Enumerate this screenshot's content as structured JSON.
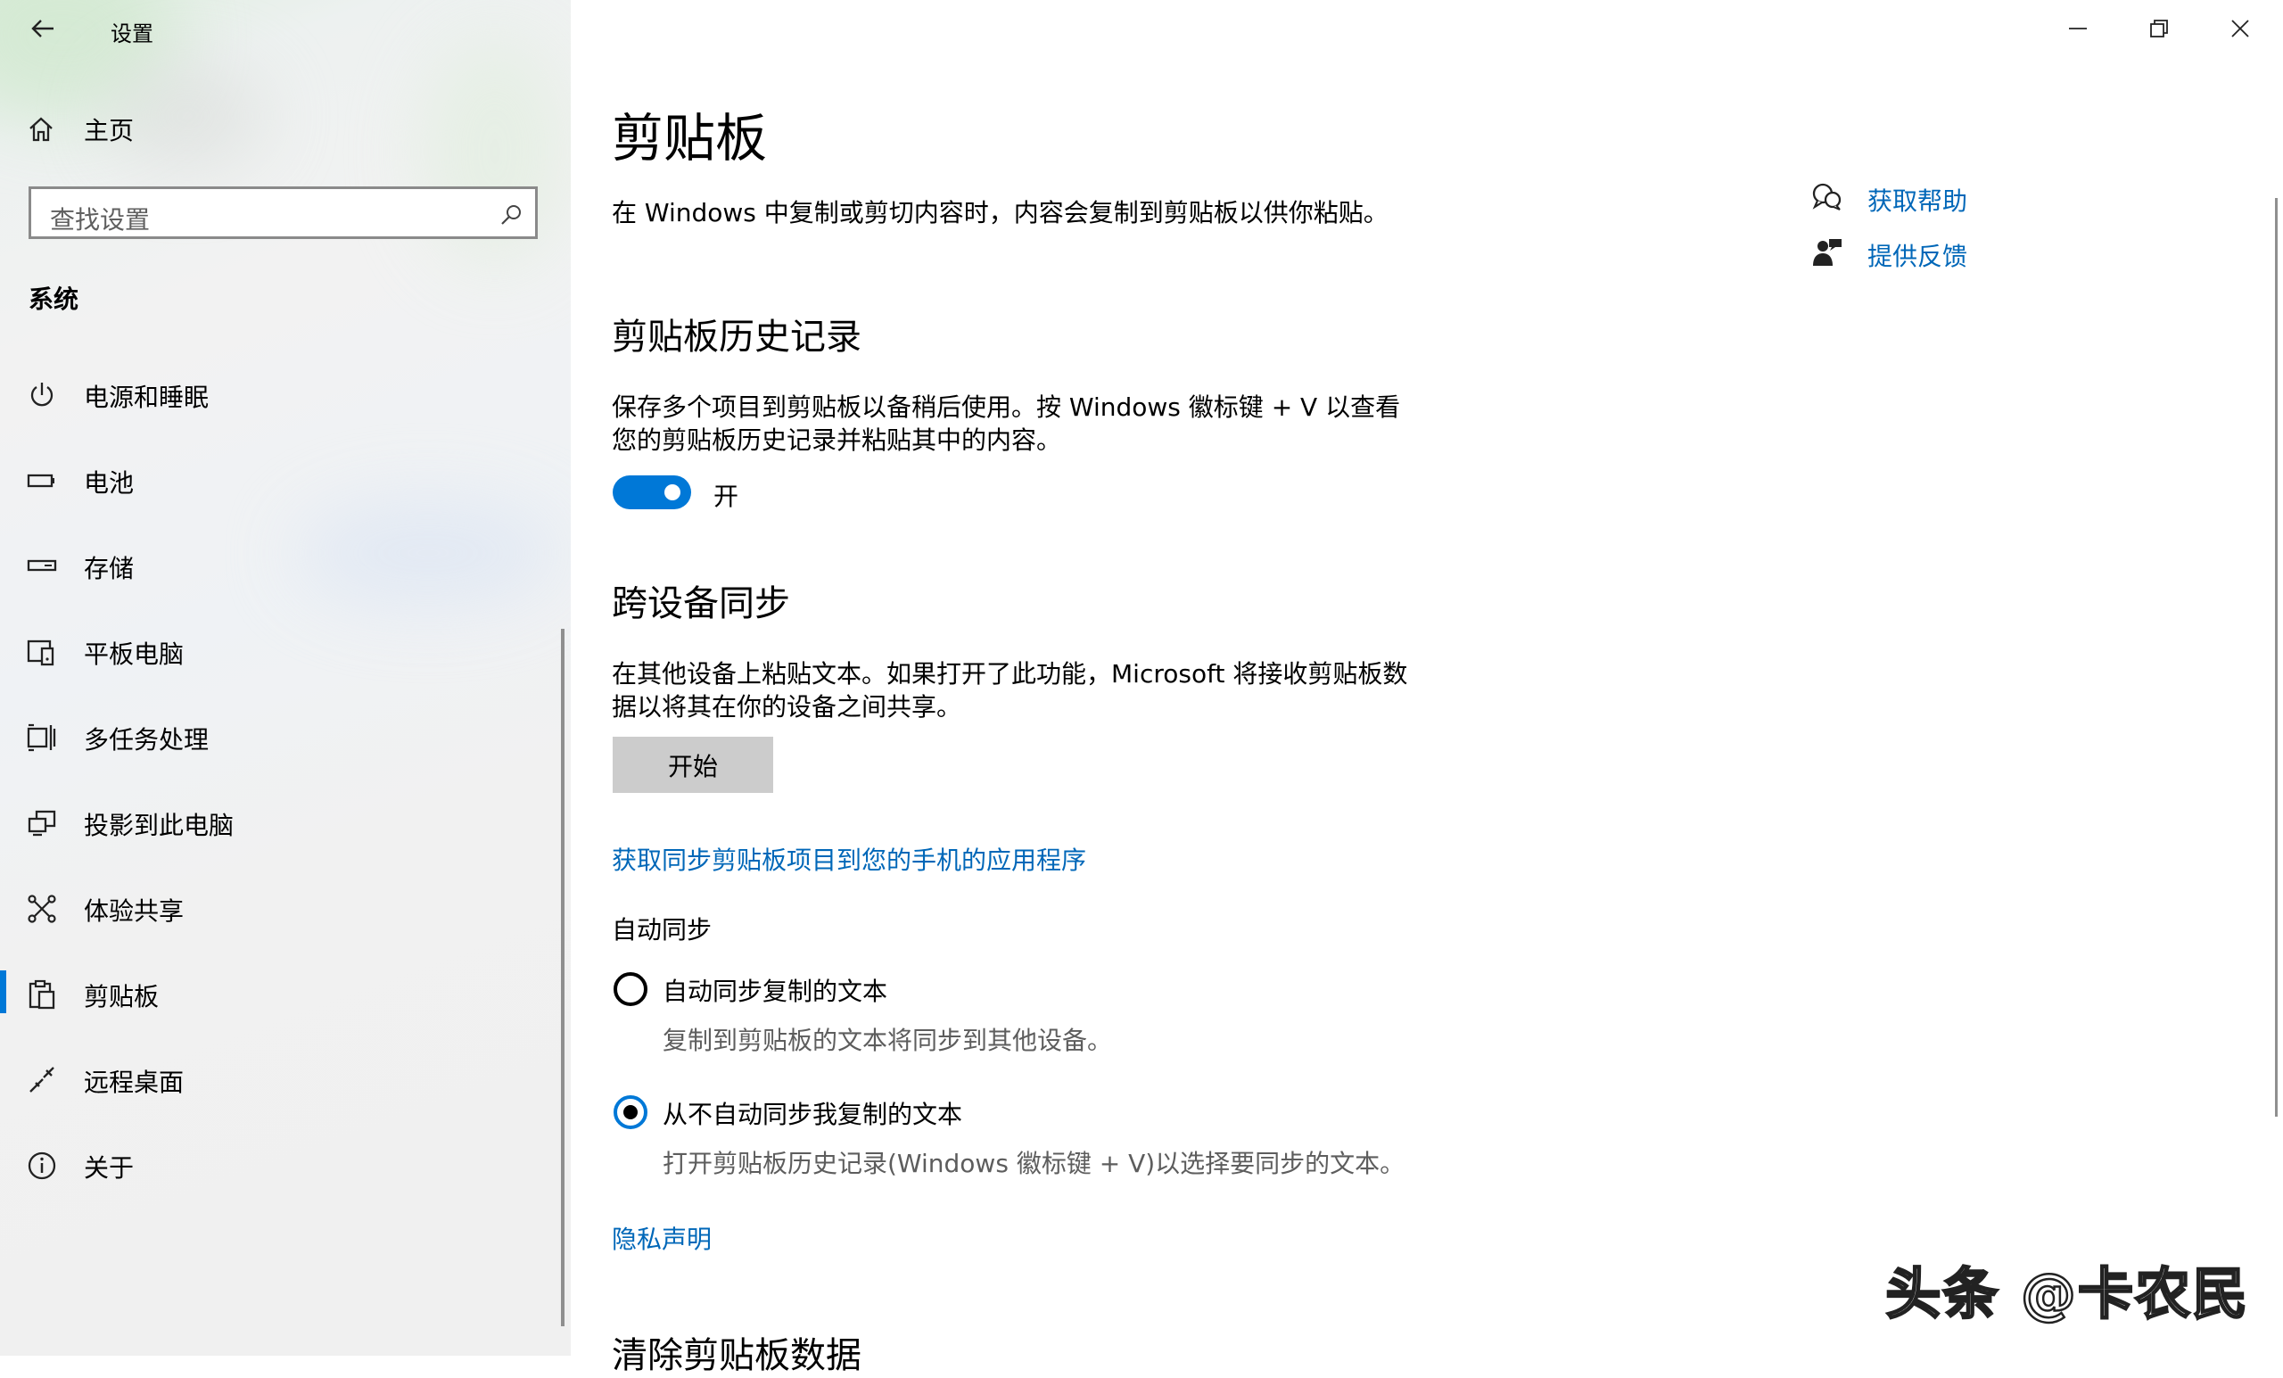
{
  "window": {
    "title": "设置",
    "controls": [
      "minimize",
      "restore",
      "close"
    ]
  },
  "sidebar": {
    "home_label": "主页",
    "search_placeholder": "查找设置",
    "section_title": "系统",
    "items": [
      {
        "label": "电源和睡眠",
        "icon": "power-icon"
      },
      {
        "label": "电池",
        "icon": "battery-icon"
      },
      {
        "label": "存储",
        "icon": "storage-icon"
      },
      {
        "label": "平板电脑",
        "icon": "tablet-icon"
      },
      {
        "label": "多任务处理",
        "icon": "multitasking-icon"
      },
      {
        "label": "投影到此电脑",
        "icon": "project-icon"
      },
      {
        "label": "体验共享",
        "icon": "shared-experiences-icon"
      },
      {
        "label": "剪贴板",
        "icon": "clipboard-icon",
        "active": true
      },
      {
        "label": "远程桌面",
        "icon": "remote-desktop-icon"
      },
      {
        "label": "关于",
        "icon": "info-icon"
      }
    ]
  },
  "main": {
    "title": "剪贴板",
    "intro": "在 Windows 中复制或剪切内容时，内容会复制到剪贴板以供你粘贴。",
    "history": {
      "heading": "剪贴板历史记录",
      "desc_line1": "保存多个项目到剪贴板以备稍后使用。按 Windows 徽标键 + V 以查看",
      "desc_line2": "您的剪贴板历史记录并粘贴其中的内容。",
      "toggle_state": "开",
      "toggle_on": true
    },
    "sync": {
      "heading": "跨设备同步",
      "desc_line1": "在其他设备上粘贴文本。如果打开了此功能，Microsoft 将接收剪贴板数",
      "desc_line2": "据以将其在你的设备之间共享。",
      "start_button": "开始",
      "phone_link": "获取同步剪贴板项目到您的手机的应用程序",
      "auto_sync_label": "自动同步",
      "options": [
        {
          "label": "自动同步复制的文本",
          "sub": "复制到剪贴板的文本将同步到其他设备。",
          "checked": false
        },
        {
          "label": "从不自动同步我复制的文本",
          "sub": "打开剪贴板历史记录(Windows 徽标键 + V)以选择要同步的文本。",
          "checked": true
        }
      ],
      "privacy_link": "隐私声明"
    },
    "clear_heading": "清除剪贴板数据"
  },
  "help": {
    "get_help": "获取帮助",
    "feedback": "提供反馈"
  },
  "watermark": "头条 @卡农民",
  "colors": {
    "accent": "#0078d7",
    "link": "#0067b8"
  }
}
